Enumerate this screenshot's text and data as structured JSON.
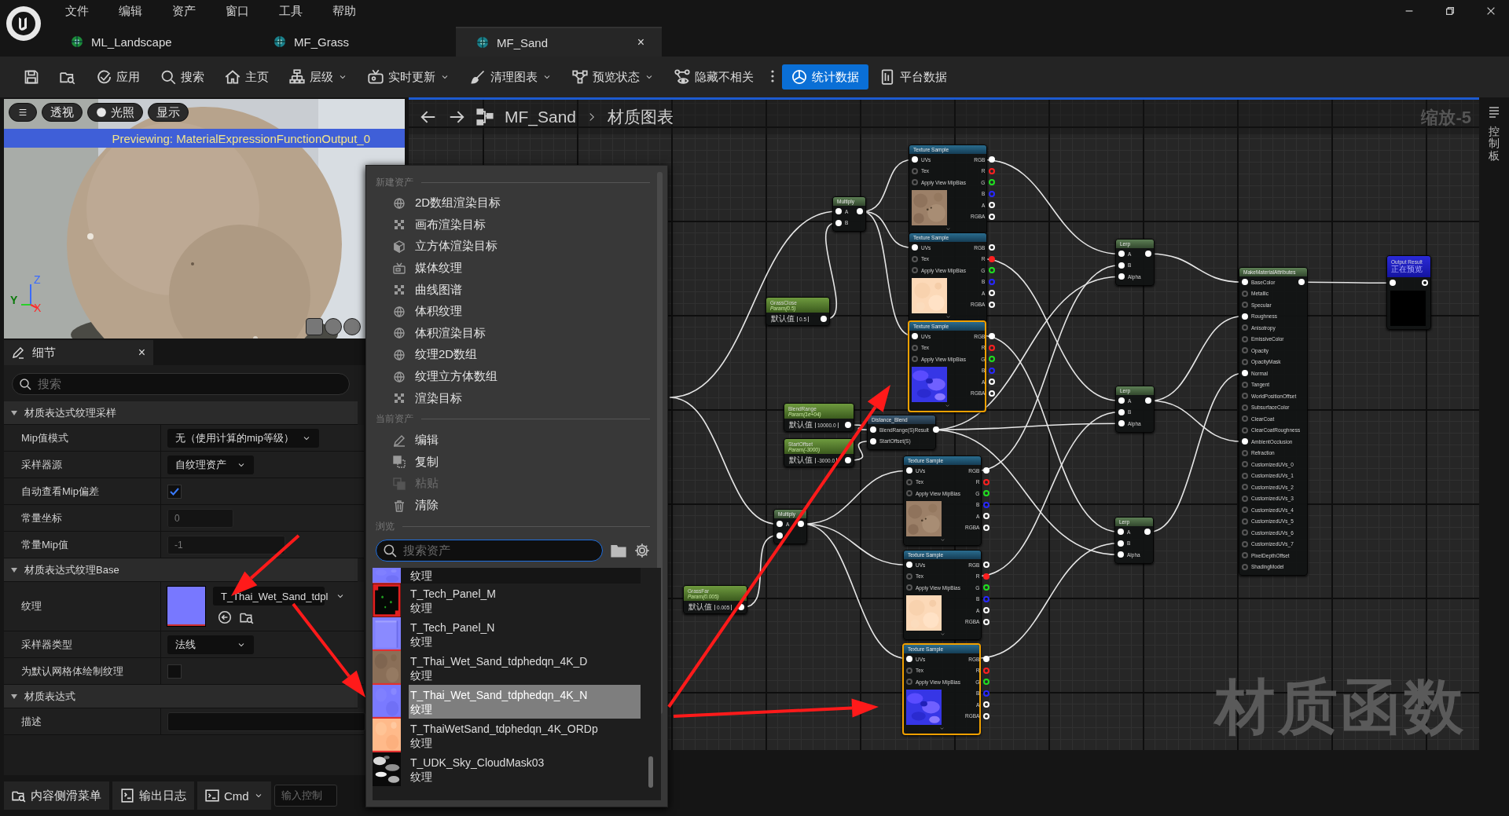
{
  "menu": [
    "文件",
    "编辑",
    "资产",
    "窗口",
    "工具",
    "帮助"
  ],
  "tabs": [
    {
      "label": "ML_Landscape",
      "selected": false
    },
    {
      "label": "MF_Grass",
      "selected": false
    },
    {
      "label": "MF_Sand",
      "selected": true,
      "close": "×"
    }
  ],
  "toolbar": [
    {
      "kind": "icon"
    },
    {
      "kind": "icon"
    },
    {
      "kind": "button",
      "label": "应用",
      "on": false,
      "dropdown": false
    },
    {
      "kind": "button",
      "label": "搜索",
      "on": false,
      "dropdown": false
    },
    {
      "kind": "button",
      "label": "主页",
      "on": false,
      "dropdown": false
    },
    {
      "kind": "button",
      "label": "层级",
      "on": false,
      "dropdown": true
    },
    {
      "kind": "button",
      "label": "实时更新",
      "on": false,
      "dropdown": true
    },
    {
      "kind": "button",
      "label": "清理图表",
      "on": false,
      "dropdown": true
    },
    {
      "kind": "button",
      "label": "预览状态",
      "on": false,
      "dropdown": true
    },
    {
      "kind": "button",
      "label": "隐藏不相关",
      "on": false,
      "dropdown": false
    },
    {
      "kind": "more"
    },
    {
      "kind": "button",
      "label": "统计数据",
      "on": true,
      "dropdown": false
    },
    {
      "kind": "button",
      "label": "平台数据",
      "on": false,
      "dropdown": false
    }
  ],
  "viewport": {
    "buttons": [
      "透视",
      "光照",
      "显示"
    ],
    "banner": "Previewing: MaterialExpressionFunctionOutput_0",
    "axes": [
      "Z",
      "Y",
      "X"
    ]
  },
  "details": {
    "tab": "细节",
    "close": "×",
    "search_placeholder": "搜索",
    "sections": [
      {
        "title": "材质表达式纹理采样",
        "expanded": true,
        "rows": [
          {
            "label": "Mip值模式",
            "kind": "dropdown",
            "value": "无（使用计算的mip等级）"
          },
          {
            "label": "采样器源",
            "kind": "dropdown",
            "value": "自纹理资产"
          },
          {
            "label": "自动查看Mip偏差",
            "kind": "checkbox",
            "checked": true
          },
          {
            "label": "常量坐标",
            "kind": "number",
            "value": "0"
          },
          {
            "label": "常量Mip值",
            "kind": "number",
            "value": "-1"
          }
        ]
      },
      {
        "title": "材质表达式纹理Base",
        "expanded": true,
        "rows": [
          {
            "label": "纹理",
            "kind": "asset",
            "value": "T_Thai_Wet_Sand_tdpl"
          },
          {
            "label": "采样器类型",
            "kind": "dropdown",
            "value": "法线"
          },
          {
            "label": "为默认网格体绘制纹理",
            "kind": "checkbox",
            "checked": false
          }
        ]
      },
      {
        "title": "材质表达式",
        "expanded": true,
        "rows": [
          {
            "label": "描述",
            "kind": "text"
          }
        ]
      }
    ]
  },
  "bottom_bar": {
    "items": [
      {
        "label": "内容侧滑菜单",
        "dropdown": false
      },
      {
        "label": "输出日志",
        "dropdown": false
      },
      {
        "label": "Cmd",
        "dropdown": true
      }
    ],
    "console_placeholder": "输入控制"
  },
  "popup": {
    "sections": [
      {
        "title": "新建资产",
        "items": [
          {
            "label": "2D数组渲染目标",
            "disabled": false
          },
          {
            "label": "画布渲染目标",
            "disabled": false
          },
          {
            "label": "立方体渲染目标",
            "disabled": false
          },
          {
            "label": "媒体纹理",
            "disabled": false
          },
          {
            "label": "曲线图谱",
            "disabled": false
          },
          {
            "label": "体积纹理",
            "disabled": false
          },
          {
            "label": "体积渲染目标",
            "disabled": false
          },
          {
            "label": "纹理2D数组",
            "disabled": false
          },
          {
            "label": "纹理立方体数组",
            "disabled": false
          },
          {
            "label": "渲染目标",
            "disabled": false
          }
        ]
      },
      {
        "title": "当前资产",
        "items": [
          {
            "label": "编辑",
            "disabled": false
          },
          {
            "label": "复制",
            "disabled": false
          },
          {
            "label": "粘贴",
            "disabled": true
          },
          {
            "label": "清除",
            "disabled": false
          }
        ]
      },
      {
        "title": "浏览"
      }
    ],
    "search_placeholder": "搜索资产",
    "assets": [
      {
        "type": "纹理",
        "selected": false
      },
      {
        "name": "T_Tech_Panel_M",
        "type": "纹理",
        "selected": false
      },
      {
        "name": "T_Tech_Panel_N",
        "type": "纹理",
        "selected": false
      },
      {
        "name": "T_Thai_Wet_Sand_tdphedqn_4K_D",
        "type": "纹理",
        "selected": false
      },
      {
        "name": "T_Thai_Wet_Sand_tdphedqn_4K_N",
        "type": "纹理",
        "selected": true
      },
      {
        "name": "T_ThaiWetSand_tdphedqn_4K_ORDp",
        "type": "纹理",
        "selected": false
      },
      {
        "name": "T_UDK_Sky_CloudMask03",
        "type": "纹理",
        "selected": false
      }
    ]
  },
  "graph": {
    "breadcrumb": [
      "MF_Sand",
      "材质图表"
    ],
    "zoom": "缩放-5",
    "watermark": "材质函数",
    "nodes": [
      {
        "kind": "texture_sample",
        "title": "Texture Sample",
        "selected": false,
        "inputs": [
          {
            "label": "UVs",
            "connected": true
          },
          {
            "label": "Tex",
            "connected": false
          },
          {
            "label": "Apply View MipBias",
            "connected": false
          }
        ],
        "outputs": [
          {
            "label": "RGB",
            "connected": true,
            "color": "#ffffff"
          },
          {
            "label": "R",
            "connected": false,
            "color": "#ff2020"
          },
          {
            "label": "G",
            "connected": false,
            "color": "#20e020"
          },
          {
            "label": "B",
            "connected": false,
            "color": "#2828ff"
          },
          {
            "label": "A",
            "connected": false,
            "color": "#ffffff"
          },
          {
            "label": "RGBA",
            "connected": false,
            "color": "#ffffff"
          }
        ]
      },
      {
        "kind": "multiply",
        "title": "Multiply",
        "selected": false,
        "inputs": [
          {
            "label": "A",
            "connected": true
          },
          {
            "label": "B",
            "connected": true
          }
        ],
        "outputs": [
          {
            "connected": true,
            "color": "#ffffff"
          }
        ]
      },
      {
        "kind": "texture_sample",
        "title": "Texture Sample",
        "selected": false,
        "inputs": [
          {
            "label": "UVs",
            "connected": true
          },
          {
            "label": "Tex",
            "connected": false
          },
          {
            "label": "Apply View MipBias",
            "connected": false
          }
        ],
        "outputs": [
          {
            "label": "RGB",
            "connected": false,
            "color": "#ffffff"
          },
          {
            "label": "R",
            "connected": true,
            "color": "#ff2020"
          },
          {
            "label": "G",
            "connected": false,
            "color": "#20e020"
          },
          {
            "label": "B",
            "connected": false,
            "color": "#2828ff"
          },
          {
            "label": "A",
            "connected": false,
            "color": "#ffffff"
          },
          {
            "label": "RGBA",
            "connected": false,
            "color": "#ffffff"
          }
        ]
      },
      {
        "kind": "lerp",
        "title": "Lerp",
        "selected": false,
        "inputs": [
          {
            "label": "A",
            "connected": true
          },
          {
            "label": "B",
            "connected": true
          },
          {
            "label": "Alpha",
            "connected": true
          }
        ],
        "outputs": [
          {
            "connected": true,
            "color": "#ffffff"
          }
        ]
      },
      {
        "kind": "output",
        "title": "Output Result",
        "subtitle": "正在预览",
        "selected": false,
        "inputs": [
          {
            "connected": true
          }
        ],
        "outputs": [
          {
            "connected": false,
            "color": "#ffffff"
          }
        ]
      },
      {
        "kind": "make_attributes",
        "title": "MakeMaterialAttributes",
        "selected": false,
        "inputs": [
          {
            "label": "BaseColor",
            "connected": true
          },
          {
            "label": "Metallic",
            "connected": false
          },
          {
            "label": "Specular",
            "connected": false
          },
          {
            "label": "Roughness",
            "connected": true
          },
          {
            "label": "Anisotropy",
            "connected": false
          },
          {
            "label": "EmissiveColor",
            "connected": false
          },
          {
            "label": "Opacity",
            "connected": false
          },
          {
            "label": "OpacityMask",
            "connected": false
          },
          {
            "label": "Normal",
            "connected": true
          },
          {
            "label": "Tangent",
            "connected": false
          },
          {
            "label": "WorldPositionOffset",
            "connected": false
          },
          {
            "label": "SubsurfaceColor",
            "connected": false
          },
          {
            "label": "ClearCoat",
            "connected": false
          },
          {
            "label": "ClearCoatRoughness",
            "connected": false
          },
          {
            "label": "AmbientOcclusion",
            "connected": true
          },
          {
            "label": "Refraction",
            "connected": false
          },
          {
            "label": "CustomizedUVs_0",
            "connected": false
          },
          {
            "label": "CustomizedUVs_1",
            "connected": false
          },
          {
            "label": "CustomizedUVs_2",
            "connected": false
          },
          {
            "label": "CustomizedUVs_3",
            "connected": false
          },
          {
            "label": "CustomizedUVs_4",
            "connected": false
          },
          {
            "label": "CustomizedUVs_5",
            "connected": false
          },
          {
            "label": "CustomizedUVs_6",
            "connected": false
          },
          {
            "label": "CustomizedUVs_7",
            "connected": false
          },
          {
            "label": "PixelDepthOffset",
            "connected": false
          },
          {
            "label": "ShadingModel",
            "connected": false
          }
        ],
        "outputs": [
          {
            "connected": true,
            "color": "#ffffff"
          }
        ]
      },
      {
        "kind": "param",
        "title": "GrassClose",
        "subtitle": "Param(0.5)",
        "value_label": "默认值",
        "value": "0.5",
        "selected": false,
        "outputs": [
          {
            "connected": true,
            "color": "#ffffff"
          }
        ]
      },
      {
        "kind": "texture_sample",
        "title": "Texture Sample",
        "selected": true,
        "inputs": [
          {
            "label": "UVs",
            "connected": true
          },
          {
            "label": "Tex",
            "connected": false
          },
          {
            "label": "Apply View MipBias",
            "connected": false
          }
        ],
        "outputs": [
          {
            "label": "RGB",
            "connected": true,
            "color": "#ffffff"
          },
          {
            "label": "R",
            "connected": false,
            "color": "#ff2020"
          },
          {
            "label": "G",
            "connected": false,
            "color": "#20e020"
          },
          {
            "label": "B",
            "connected": false,
            "color": "#2828ff"
          },
          {
            "label": "A",
            "connected": false,
            "color": "#ffffff"
          },
          {
            "label": "RGBA",
            "connected": false,
            "color": "#ffffff"
          }
        ]
      },
      {
        "kind": "param",
        "title": "BlendRange",
        "subtitle": "Param(1e+04)",
        "value_label": "默认值",
        "value": "10000.0",
        "selected": false,
        "outputs": [
          {
            "connected": true,
            "color": "#ffffff"
          }
        ]
      },
      {
        "kind": "distance_blend",
        "title": "Distance_Blend",
        "selected": false,
        "inputs": [
          {
            "label": "BlendRange(S)",
            "connected": true
          },
          {
            "label": "StartOffset(S)",
            "connected": true
          }
        ],
        "outputs": [
          {
            "label": "Result",
            "connected": true,
            "color": "#ffffff"
          }
        ]
      },
      {
        "kind": "lerp",
        "title": "Lerp",
        "selected": false,
        "inputs": [
          {
            "label": "A",
            "connected": true
          },
          {
            "label": "B",
            "connected": true
          },
          {
            "label": "Alpha",
            "connected": true
          }
        ],
        "outputs": [
          {
            "connected": true,
            "color": "#ffffff"
          }
        ]
      },
      {
        "kind": "param",
        "title": "StartOffset",
        "subtitle": "Param(-3000)",
        "value_label": "默认值",
        "value": "-3000.0",
        "selected": false,
        "outputs": [
          {
            "connected": true,
            "color": "#ffffff"
          }
        ]
      },
      {
        "kind": "texture_sample",
        "title": "Texture Sample",
        "selected": false,
        "inputs": [
          {
            "label": "UVs",
            "connected": true
          },
          {
            "label": "Tex",
            "connected": false
          },
          {
            "label": "Apply View MipBias",
            "connected": false
          }
        ],
        "outputs": [
          {
            "label": "RGB",
            "connected": true,
            "color": "#ffffff"
          },
          {
            "label": "R",
            "connected": false,
            "color": "#ff2020"
          },
          {
            "label": "G",
            "connected": false,
            "color": "#20e020"
          },
          {
            "label": "B",
            "connected": false,
            "color": "#2828ff"
          },
          {
            "label": "A",
            "connected": false,
            "color": "#ffffff"
          },
          {
            "label": "RGBA",
            "connected": false,
            "color": "#ffffff"
          }
        ]
      },
      {
        "kind": "multiply",
        "title": "Multiply",
        "selected": false,
        "inputs": [
          {
            "label": "A",
            "connected": true
          },
          {
            "connected": true
          }
        ],
        "outputs": [
          {
            "connected": true,
            "color": "#ffffff"
          }
        ]
      },
      {
        "kind": "lerp",
        "title": "Lerp",
        "selected": false,
        "inputs": [
          {
            "label": "A",
            "connected": true
          },
          {
            "label": "B",
            "connected": true
          },
          {
            "label": "Alpha",
            "connected": true
          }
        ],
        "outputs": [
          {
            "connected": true,
            "color": "#ffffff"
          }
        ]
      },
      {
        "kind": "texture_sample",
        "title": "Texture Sample",
        "selected": false,
        "inputs": [
          {
            "label": "UVs",
            "connected": true
          },
          {
            "label": "Tex",
            "connected": false
          },
          {
            "label": "Apply View MipBias",
            "connected": false
          }
        ],
        "outputs": [
          {
            "label": "RGB",
            "connected": false,
            "color": "#ffffff"
          },
          {
            "label": "R",
            "connected": true,
            "color": "#ff2020"
          },
          {
            "label": "G",
            "connected": false,
            "color": "#20e020"
          },
          {
            "label": "B",
            "connected": false,
            "color": "#2828ff"
          },
          {
            "label": "A",
            "connected": false,
            "color": "#ffffff"
          },
          {
            "label": "RGBA",
            "connected": false,
            "color": "#ffffff"
          }
        ]
      },
      {
        "kind": "param",
        "title": "GrassFar",
        "subtitle": "Param(0.005)",
        "value_label": "默认值",
        "value": "0.005",
        "selected": false,
        "outputs": [
          {
            "connected": true,
            "color": "#ffffff"
          }
        ]
      },
      {
        "kind": "texture_sample",
        "title": "Texture Sample",
        "selected": true,
        "inputs": [
          {
            "label": "UVs",
            "connected": true
          },
          {
            "label": "Tex",
            "connected": false
          },
          {
            "label": "Apply View MipBias",
            "connected": false
          }
        ],
        "outputs": [
          {
            "label": "RGB",
            "connected": true,
            "color": "#ffffff"
          },
          {
            "label": "R",
            "connected": false,
            "color": "#ff2020"
          },
          {
            "label": "G",
            "connected": false,
            "color": "#20e020"
          },
          {
            "label": "B",
            "connected": false,
            "color": "#2828ff"
          },
          {
            "label": "A",
            "connected": false,
            "color": "#ffffff"
          },
          {
            "label": "RGBA",
            "connected": false,
            "color": "#ffffff"
          }
        ]
      }
    ]
  },
  "sidebar": {
    "label": "控制板"
  },
  "annotations": [
    {
      "kind": "arrow"
    },
    {
      "kind": "arrow"
    },
    {
      "kind": "arrow"
    },
    {
      "kind": "arrow"
    }
  ]
}
